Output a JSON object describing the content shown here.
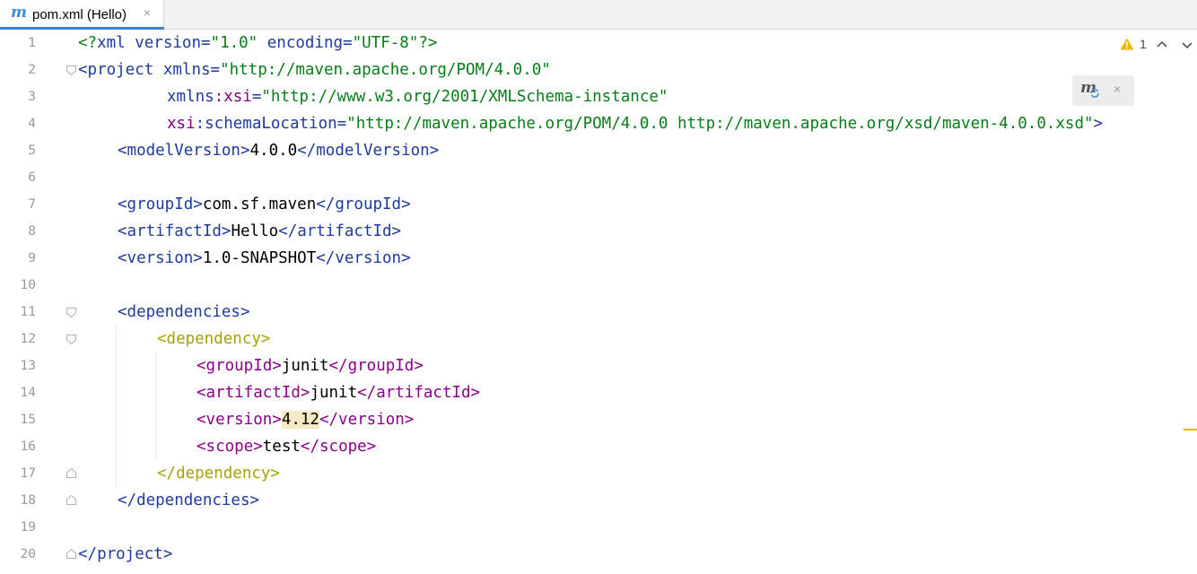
{
  "tab": {
    "icon": "m",
    "label": "pom.xml (Hello)",
    "close": "×"
  },
  "inspection": {
    "warning_count": "1",
    "up": "⌃",
    "down": "⌄"
  },
  "maven_popup": {
    "icon": "m",
    "close": "×"
  },
  "gutter": {
    "lines": [
      "1",
      "2",
      "3",
      "4",
      "5",
      "6",
      "7",
      "8",
      "9",
      "10",
      "11",
      "12",
      "13",
      "14",
      "15",
      "16",
      "17",
      "18",
      "19",
      "20"
    ]
  },
  "code": {
    "l1": {
      "a": "<?",
      "b": "xml",
      "c": " version",
      "d": "=",
      "e": "\"1.0\"",
      "f": " encoding",
      "g": "=",
      "h": "\"UTF-8\"",
      "i": "?>"
    },
    "l2": {
      "a": "<project",
      "b": " xmlns",
      "c": "=",
      "d": "\"http://maven.apache.org/POM/4.0.0\""
    },
    "l3": {
      "a": "xmlns",
      "b": ":xsi",
      "c": "=",
      "d": "\"http://www.w3.org/2001/XMLSchema-instance\""
    },
    "l4": {
      "a": "xsi",
      "b": ":schemaLocation",
      "c": "=",
      "d": "\"http://maven.apache.org/POM/4.0.0 http://maven.apache.org/xsd/maven-4.0.0.xsd\"",
      "e": ">"
    },
    "l5": {
      "a": "<modelVersion>",
      "b": "4.0.0",
      "c": "</modelVersion>"
    },
    "l7": {
      "a": "<groupId>",
      "b": "com.sf.maven",
      "c": "</groupId>"
    },
    "l8": {
      "a": "<artifactId>",
      "b": "Hello",
      "c": "</artifactId>"
    },
    "l9": {
      "a": "<version>",
      "b": "1.0-SNAPSHOT",
      "c": "</version>"
    },
    "l11": {
      "a": "<dependencies>"
    },
    "l12": {
      "a": "<dependency>"
    },
    "l13": {
      "a": "<groupId>",
      "b": "junit",
      "c": "</groupId>"
    },
    "l14": {
      "a": "<artifactId>",
      "b": "junit",
      "c": "</artifactId>"
    },
    "l15": {
      "a": "<version>",
      "b": "4.12",
      "c": "</version>"
    },
    "l16": {
      "a": "<scope>",
      "b": "test",
      "c": "</scope>"
    },
    "l17": {
      "a": "</dependency>"
    },
    "l18": {
      "a": "</dependencies>"
    },
    "l20": {
      "a": "</project>"
    }
  }
}
